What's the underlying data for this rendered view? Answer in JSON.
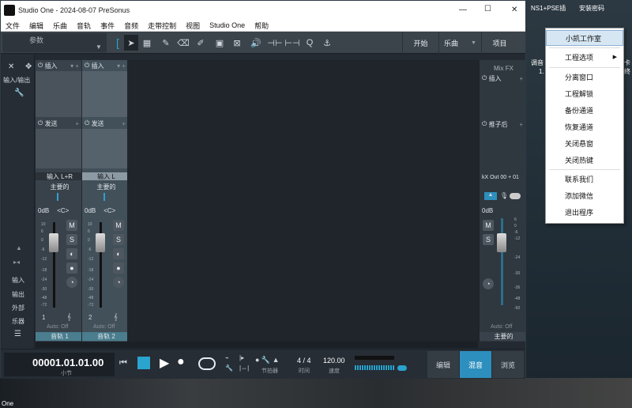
{
  "window": {
    "title": "Studio One - 2024-08-07 PreSonus",
    "min": "—",
    "max": "☐",
    "close": "✕"
  },
  "menubar": [
    "文件",
    "编辑",
    "乐曲",
    "音轨",
    "事件",
    "音频",
    "走带控制",
    "视图",
    "Studio One",
    "帮助"
  ],
  "toolbar": {
    "params_label": "参数",
    "start": "开始",
    "song": "乐曲",
    "project": "项目"
  },
  "leftpanel": {
    "input_mode": "输入/输出",
    "items": [
      "输入",
      "输出",
      "外部",
      "乐器"
    ]
  },
  "channels": [
    {
      "insert": "插入",
      "send": "发送",
      "input": "输入 L+R",
      "bus": "主要的",
      "db": "0dB",
      "pan": "<C>",
      "num": "1",
      "auto": "Auto: Off",
      "name": "音轨 1"
    },
    {
      "insert": "插入",
      "send": "发送",
      "input": "输入 L",
      "bus": "主要的",
      "db": "0dB",
      "pan": "<C>",
      "num": "2",
      "auto": "Auto: Off",
      "name": "音轨 2"
    }
  ],
  "strip_buttons": {
    "mute": "M",
    "solo": "S"
  },
  "fader_scale": [
    "10",
    "6",
    "0",
    "-6",
    "-12",
    "-18",
    "-24",
    "-30",
    "-48",
    "-72"
  ],
  "master": {
    "mixfx": "Mix FX",
    "insert": "插入",
    "post": "推子后",
    "output": "kX Out 00 + 01",
    "db": "0dB",
    "mute": "M",
    "solo": "S",
    "auto": "Auto: Off",
    "name": "主要的",
    "scale": [
      "6",
      "0",
      "-6",
      "-12",
      "-24",
      "-30",
      "-36",
      "-48",
      "-60"
    ]
  },
  "transport": {
    "position": "00001.01.01.00",
    "position_unit": "小节",
    "metronome": "节拍器",
    "signature": "4 / 4",
    "signature_label": "时间",
    "tempo": "120.00",
    "tempo_label": "速度"
  },
  "views": {
    "edit": "编辑",
    "mix": "混音",
    "browse": "浏览"
  },
  "desktop": {
    "top_left": "NS1+PSE插",
    "top_right": "安装密码",
    "side": "调音",
    "side_num": "1.",
    "bottom_left": "One",
    "side_right": "卡终"
  },
  "context_menu": [
    "小凯工作室",
    "工程选项",
    "分离窗口",
    "工程解锁",
    "备份通道",
    "恢复通道",
    "关闭悬窗",
    "关闭热键",
    "联系我们",
    "添加微信",
    "退出程序"
  ],
  "colors": {
    "accent": "#2aa3cf",
    "selected_view": "#2d8fbd"
  }
}
